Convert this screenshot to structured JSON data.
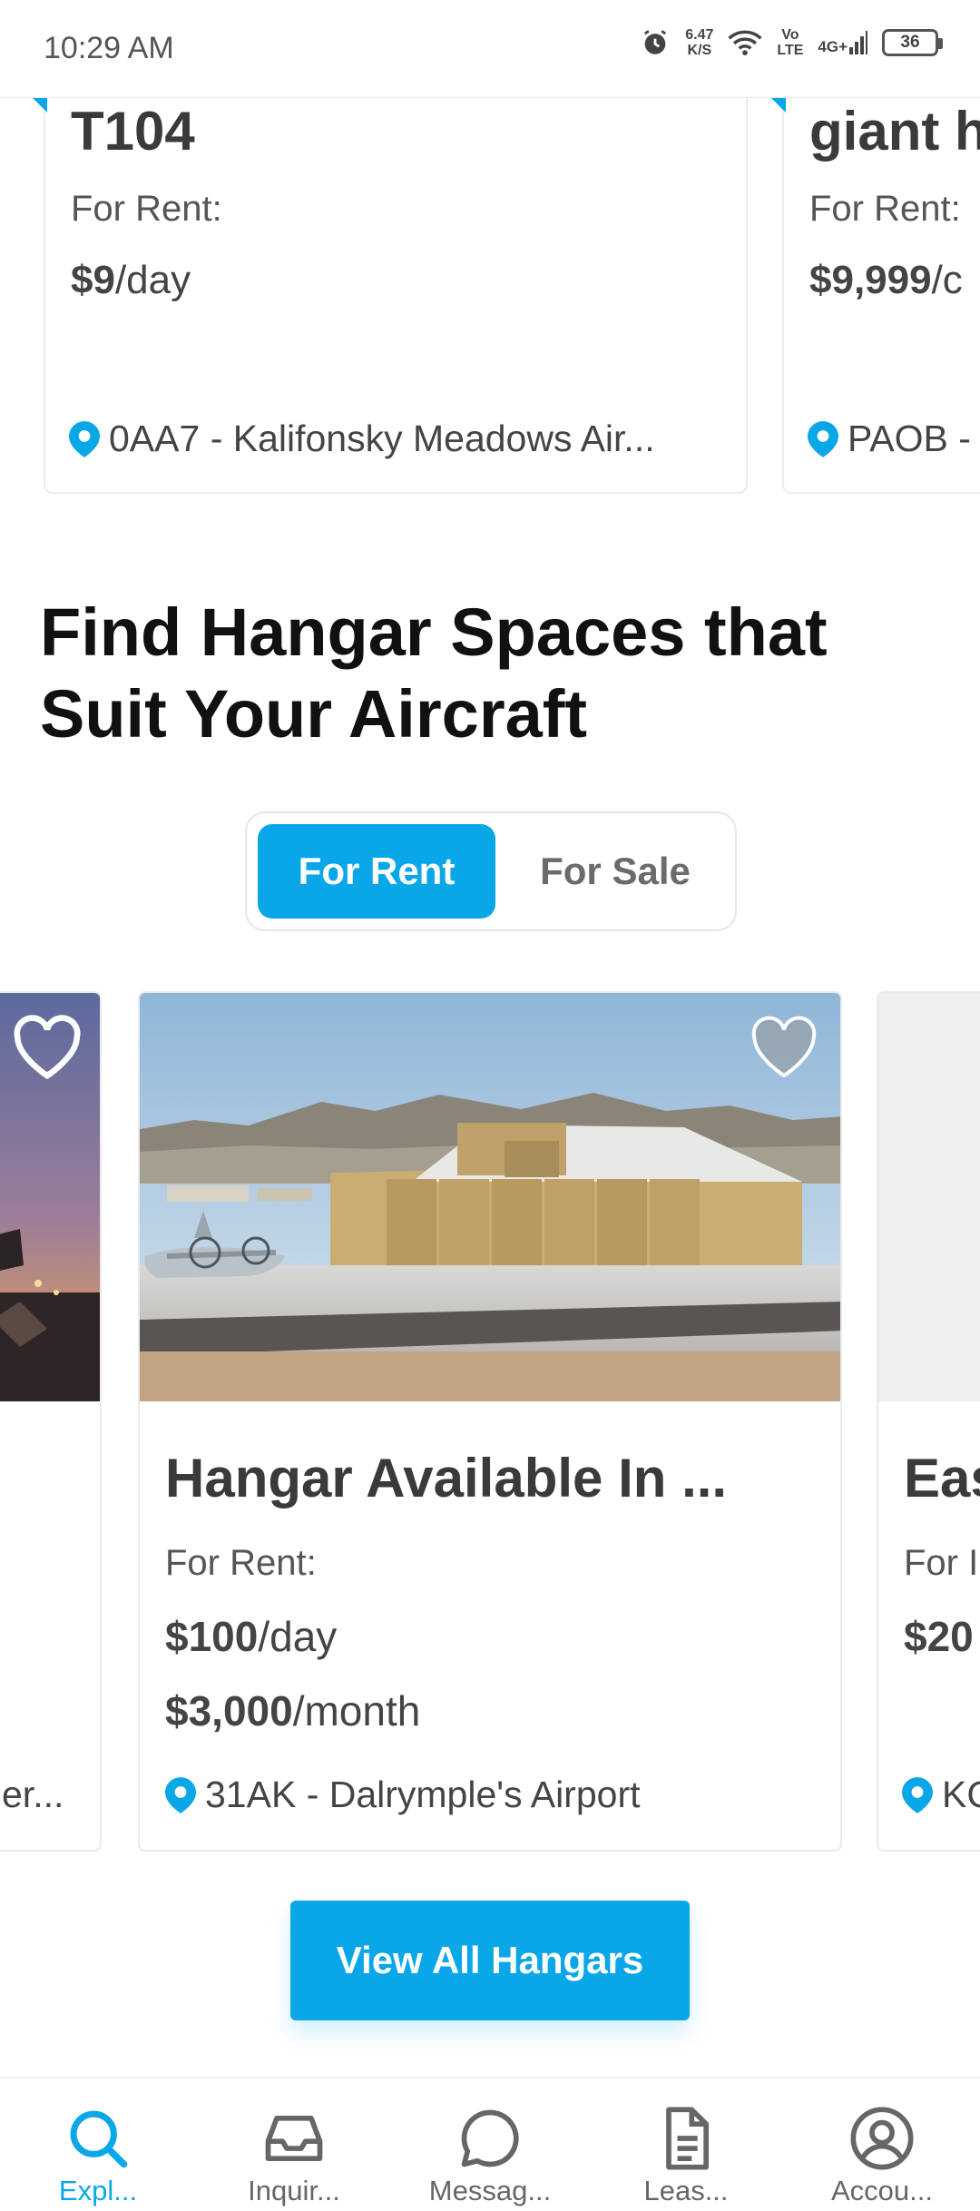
{
  "status_bar": {
    "time": "10:29 AM",
    "net_speed_top": "6.47",
    "net_speed_bottom": "K/S",
    "volte_top": "Vo",
    "volte_bottom": "LTE",
    "network": "4G+",
    "battery": "36"
  },
  "top_carousel": {
    "cards": [
      {
        "title": "T104",
        "rent_label": "For Rent:",
        "price_value": "$9",
        "price_unit": "/day",
        "location": "0AA7 - Kalifonsky Meadows Air..."
      },
      {
        "title": "giant h",
        "rent_label": "For Rent:",
        "price_value": "$9,999",
        "price_unit": "/c",
        "location": "PAOB - "
      }
    ]
  },
  "section": {
    "title": "Find Hangar Spaces that Suit Your Aircraft"
  },
  "toggle": {
    "options": [
      "For Rent",
      "For Sale"
    ],
    "selected": "For Rent"
  },
  "hangar_cards": [
    {
      "location": "er..."
    },
    {
      "title": "Hangar Available In ...",
      "rent_label": "For Rent:",
      "price_day_value": "$100",
      "price_day_unit": "/day",
      "price_month_value": "$3,000",
      "price_month_unit": "/month",
      "location": "31AK - Dalrymple's Airport"
    },
    {
      "title": "Eas",
      "rent_label": "For I",
      "price_value": "$20",
      "location": "KC"
    }
  ],
  "view_all_label": "View All Hangars",
  "bottom_nav": {
    "items": [
      {
        "label": "Expl...",
        "icon": "search-icon",
        "active": true
      },
      {
        "label": "Inquir...",
        "icon": "inbox-icon",
        "active": false
      },
      {
        "label": "Messag...",
        "icon": "chat-bubble-icon",
        "active": false
      },
      {
        "label": "Leas...",
        "icon": "document-icon",
        "active": false
      },
      {
        "label": "Accou...",
        "icon": "user-circle-icon",
        "active": false
      }
    ]
  },
  "colors": {
    "accent": "#0aa7e8",
    "text_dark": "#111111",
    "text_body": "#3a3a3a"
  }
}
